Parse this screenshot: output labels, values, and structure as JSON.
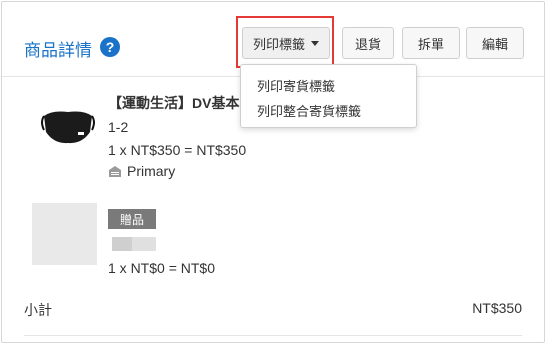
{
  "header": {
    "title": "商品詳情",
    "help_icon": "question-circle-icon",
    "buttons": {
      "print_label": "列印標籤",
      "return_label": "退貨",
      "split_label": "拆單",
      "edit_label": "編輯"
    }
  },
  "dropdown": {
    "items": [
      {
        "label": "列印寄貨標籤"
      },
      {
        "label": "列印整合寄貨標籤"
      }
    ]
  },
  "items": [
    {
      "name": "【運動生活】DV基本",
      "variant": "1-2",
      "price_line": "1 x NT$350 = NT$350",
      "warehouse": "Primary",
      "warehouse_icon": "warehouse-icon",
      "image_icon": "face-mask-icon"
    },
    {
      "badge": "贈品",
      "price_line": "1 x NT$0 = NT$0"
    }
  ],
  "summary": {
    "subtotal_label": "小計",
    "subtotal_value": "NT$350"
  },
  "colors": {
    "accent": "#1a73c8",
    "highlight": "#e53935",
    "badge_bg": "#7a7a7a"
  }
}
